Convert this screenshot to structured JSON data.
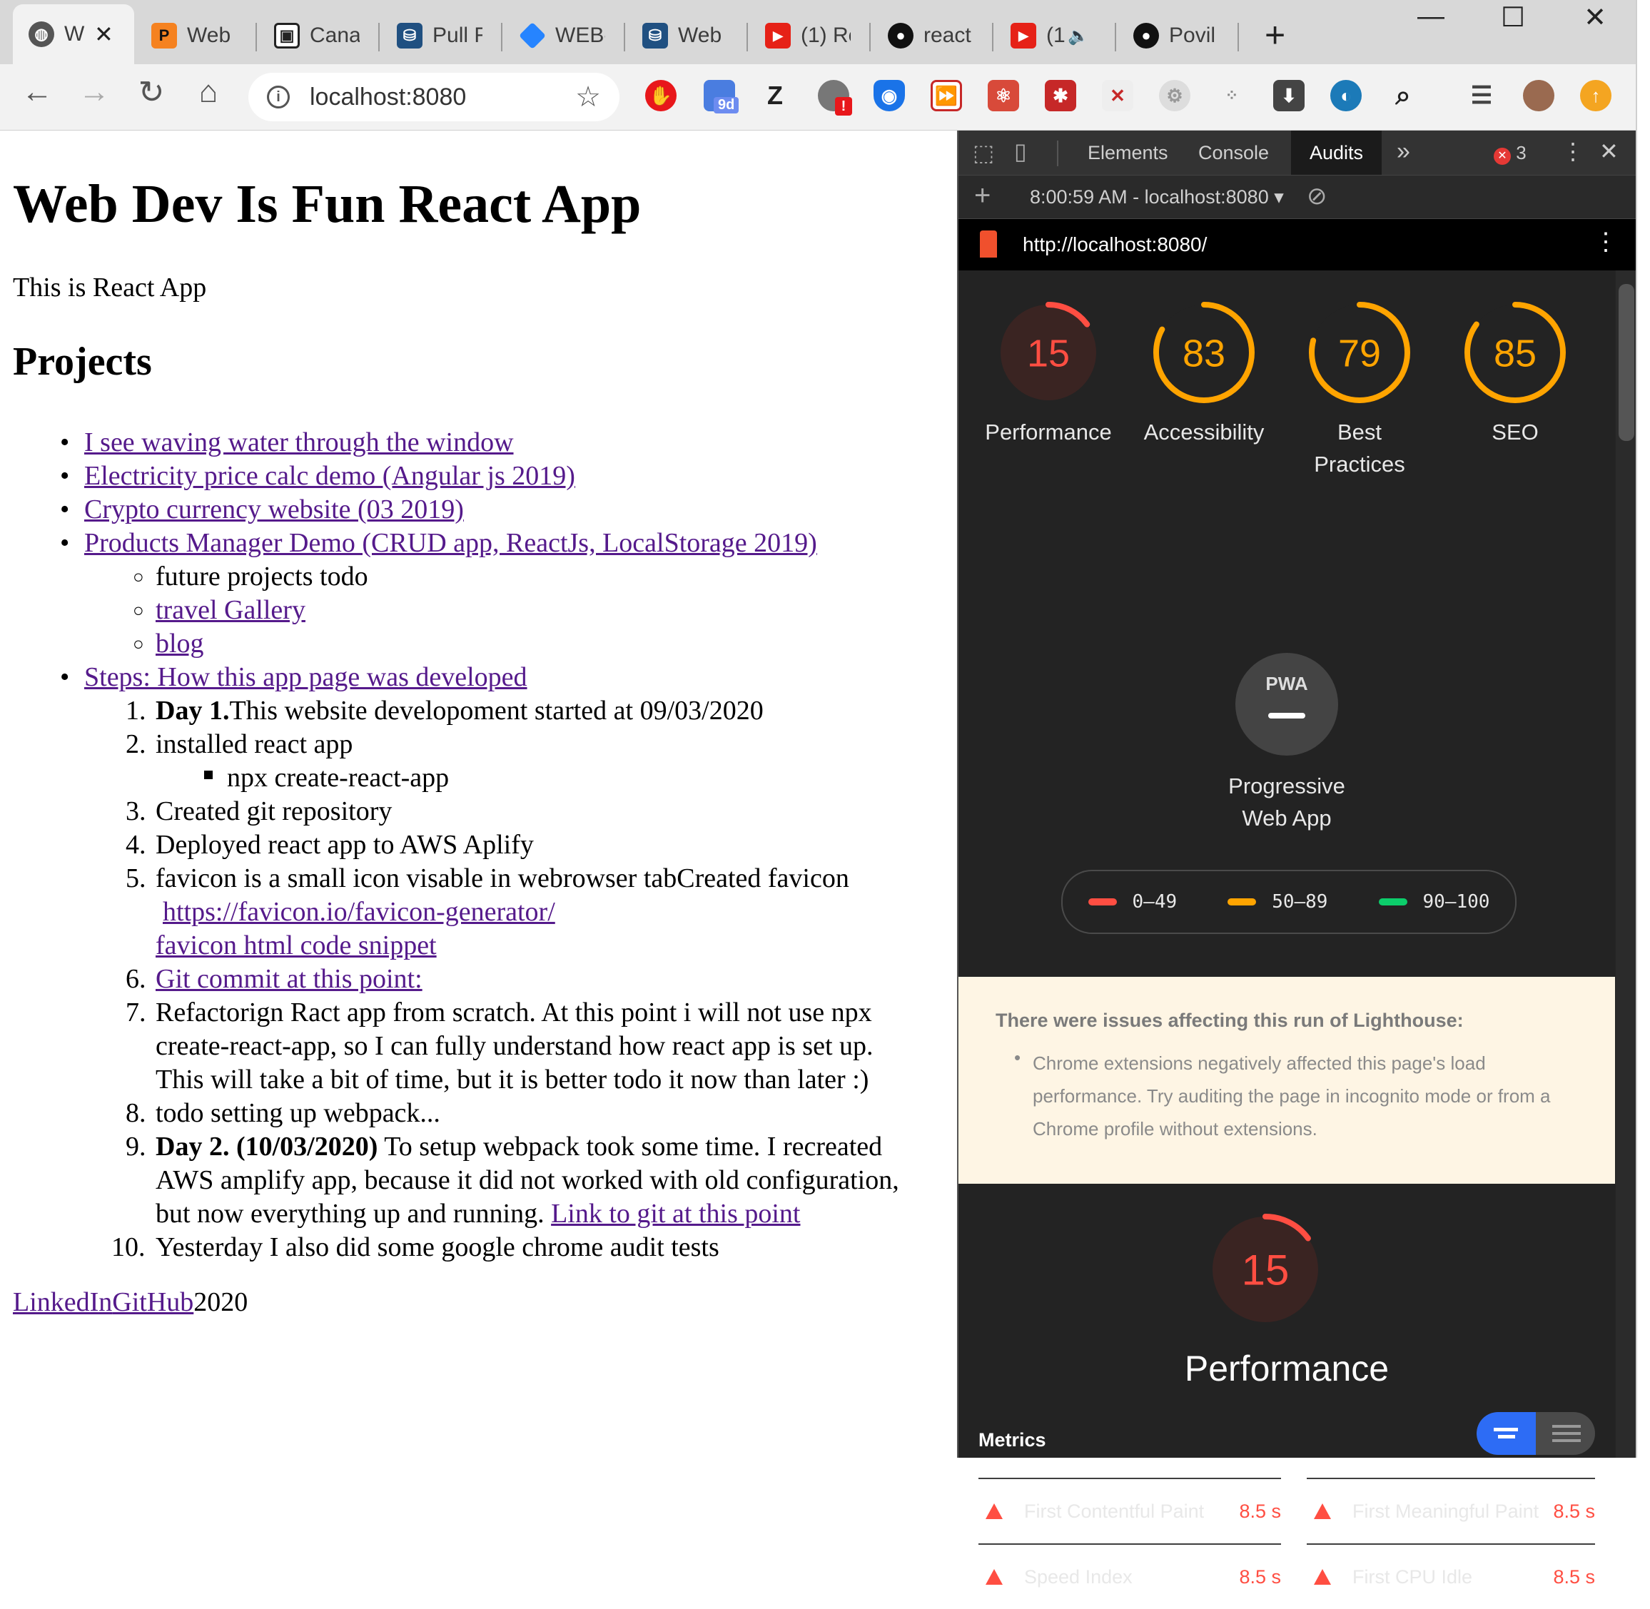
{
  "browser": {
    "tabs": [
      {
        "icon": "globe-icon",
        "title": "W",
        "active": true
      },
      {
        "icon": "patreon-icon",
        "title": "Web"
      },
      {
        "icon": "video-icon",
        "title": "Canal"
      },
      {
        "icon": "bitbucket-icon",
        "title": "Pull R"
      },
      {
        "icon": "jira-icon",
        "title": "WEB-"
      },
      {
        "icon": "bitbucket-icon",
        "title": "Web"
      },
      {
        "icon": "youtube-icon",
        "title": "(1) Re"
      },
      {
        "icon": "github-icon",
        "title": "react"
      },
      {
        "icon": "youtube-icon",
        "title": "(1"
      },
      {
        "icon": "github-icon",
        "title": "Povil"
      }
    ],
    "address": "localhost:8080",
    "ext_badge": "9d",
    "ext_letter": "Z"
  },
  "page": {
    "title": "Web Dev Is Fun React App",
    "intro": "This is React App",
    "projects_heading": "Projects",
    "projects": {
      "p1": "I see waving water through the window",
      "p2": "Electricity price calc demo (Angular js 2019)",
      "p3": "Crypto currency website (03 2019)",
      "p4": "Products Manager Demo (CRUD app, ReactJs, LocalStorage 2019)",
      "sub1": "future projects todo",
      "sub2": "travel Gallery",
      "sub3": "blog",
      "steps": "Steps: How this app page was developed"
    },
    "steps": {
      "s1_bold": "Day 1.",
      "s1_text": "This website developoment started at 09/03/2020",
      "s2": "installed react app",
      "s2_sub": "npx create-react-app",
      "s3": "Created git repository",
      "s4": "Deployed react app to AWS Aplify",
      "s5": "favicon is a small icon visable in webrowser tabCreated favicon",
      "s5_link1": "https://favicon.io/favicon-generator/",
      "s5_link2": "favicon html code snippet",
      "s6": "Git commit at this point:",
      "s7_l1": "Refactorign Ract app from scratch. At this point i will not use npx",
      "s7_l2": "create-react-app, so I can fully understand how react app is set up.",
      "s7_l3": "This will take a bit of time, but it is better todo it now than later :)",
      "s8": "todo setting up webpack...",
      "s9_bold": "Day 2. (10/03/2020)",
      "s9_l1": " To setup webpack took some time. I recreated",
      "s9_l2": "AWS amplify app, because it did not worked with old configuration,",
      "s9_l3": "but now everything up and running. ",
      "s9_link": "Link to git at this point",
      "s10": "Yesterday I also did some google chrome audit tests"
    },
    "footer": {
      "linkedin": "LinkedIn",
      "github": "GitHub",
      "year": "2020"
    }
  },
  "devtools": {
    "tabs": [
      "Elements",
      "Console",
      "Audits"
    ],
    "active_tab": "Audits",
    "more": "»",
    "error_count": "3",
    "report_time": "8:00:59 AM - localhost:8080",
    "lh_url": "http://localhost:8080/",
    "scores": [
      {
        "value": 15,
        "label1": "Performance",
        "label2": "",
        "color": "#ff4e42",
        "bg": "#3a2422"
      },
      {
        "value": 83,
        "label1": "Accessibility",
        "label2": "",
        "color": "#ffa400",
        "bg": "#232323"
      },
      {
        "value": 79,
        "label1": "Best",
        "label2": "Practices",
        "color": "#ffa400",
        "bg": "#232323"
      },
      {
        "value": 85,
        "label1": "SEO",
        "label2": "",
        "color": "#ffa400",
        "bg": "#232323"
      }
    ],
    "pwa": {
      "badge": "PWA",
      "label1": "Progressive",
      "label2": "Web App"
    },
    "legend": [
      {
        "range": "0–49",
        "color": "#ff4e42"
      },
      {
        "range": "50–89",
        "color": "#ffa400"
      },
      {
        "range": "90–100",
        "color": "#0cce6b"
      }
    ],
    "warning": {
      "title": "There were issues affecting this run of Lighthouse:",
      "item": "Chrome extensions negatively affected this page's load performance. Try auditing the page in incognito mode or from a Chrome profile without extensions."
    },
    "perf": {
      "score": 15,
      "title": "Performance",
      "metrics_label": "Metrics"
    },
    "metrics": [
      {
        "name": "First Contentful Paint",
        "value": "8.5 s"
      },
      {
        "name": "First Meaningful Paint",
        "value": "8.5 s"
      },
      {
        "name": "Speed Index",
        "value": "8.5 s"
      },
      {
        "name": "First CPU Idle",
        "value": "8.5 s"
      }
    ]
  }
}
